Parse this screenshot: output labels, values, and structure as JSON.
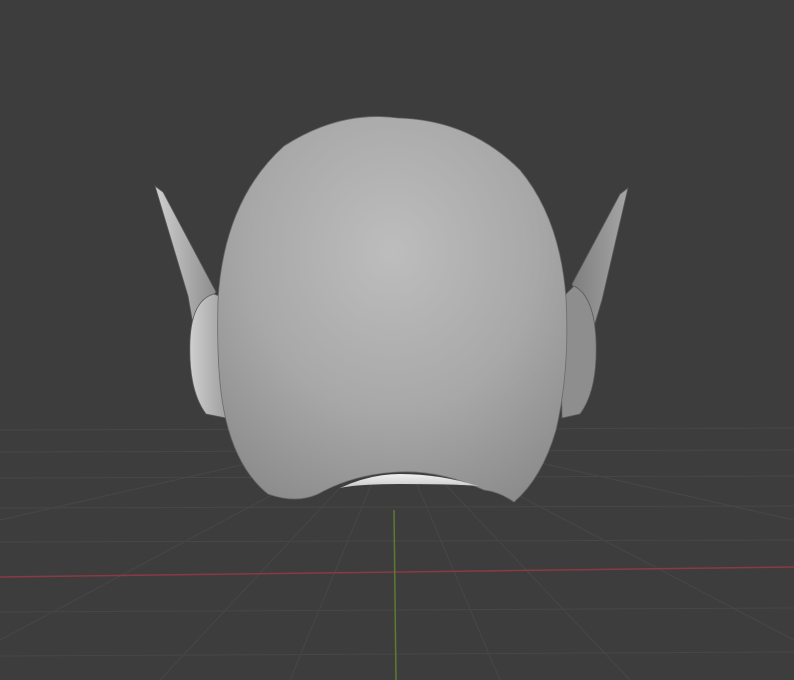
{
  "viewport": {
    "background_color": "#3d3d3d",
    "grid_line_color": "#474747",
    "x_axis_color": "#8a3a44",
    "y_axis_color": "#5e7a2f",
    "model_color": "#9e9e9e",
    "model_name": "helmet"
  }
}
